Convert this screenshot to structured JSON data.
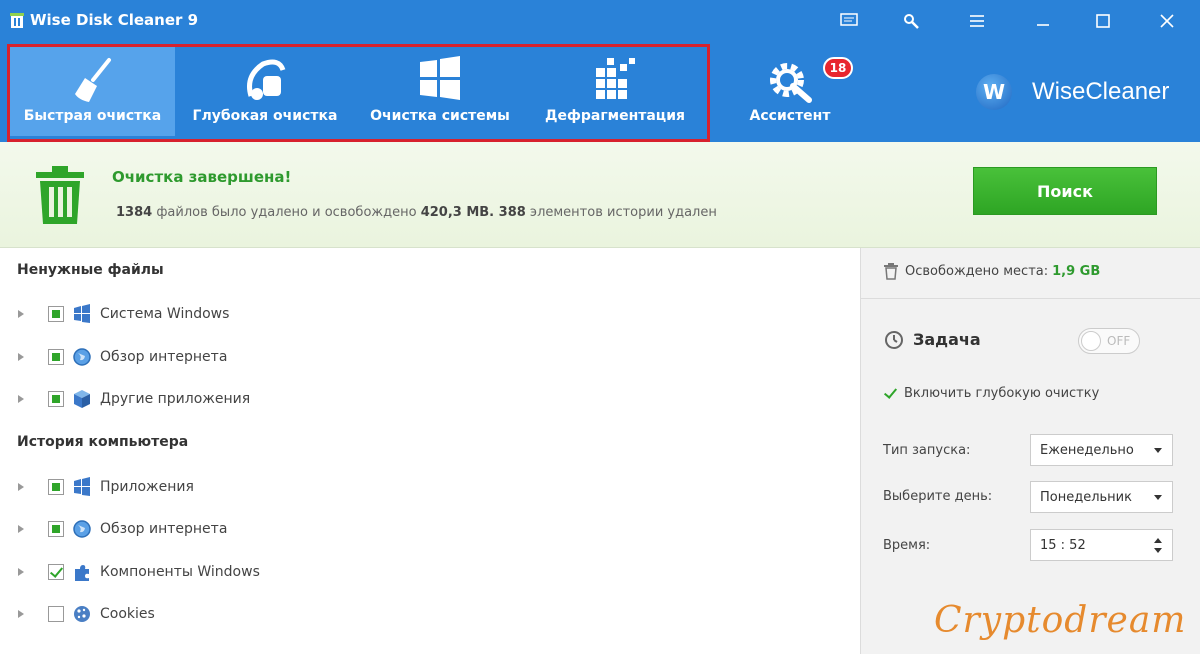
{
  "window": {
    "title": "Wise Disk Cleaner 9"
  },
  "toolbar": {
    "items": [
      {
        "label": "Быстрая очистка"
      },
      {
        "label": "Глубокая очистка"
      },
      {
        "label": "Очистка системы"
      },
      {
        "label": "Дефрагментация"
      },
      {
        "label": "Ассистент",
        "badge": "18"
      }
    ],
    "brand": "WiseCleaner",
    "brand_logo": "W"
  },
  "status": {
    "title": "Очистка завершена!",
    "files_count": "1384",
    "text1": " файлов было удалено и освобождено ",
    "freed_size": "420,3 MB.",
    "history_count": " 388",
    "text2": " элементов истории удален",
    "search_label": "Поиск"
  },
  "junk": {
    "title": "Ненужные файлы",
    "items": [
      {
        "label": "Система Windows",
        "icon": "windows-icon",
        "state": "partial"
      },
      {
        "label": "Обзор интернета",
        "icon": "globe-icon",
        "state": "partial"
      },
      {
        "label": "Другие приложения",
        "icon": "package-icon",
        "state": "partial"
      }
    ]
  },
  "history": {
    "title": "История компьютера",
    "items": [
      {
        "label": "Приложения",
        "icon": "windows-icon",
        "state": "partial"
      },
      {
        "label": "Обзор интернета",
        "icon": "globe-icon",
        "state": "partial"
      },
      {
        "label": "Компоненты Windows",
        "icon": "puzzle-icon",
        "state": "checked"
      },
      {
        "label": "Cookies",
        "icon": "cookie-icon",
        "state": "unchecked"
      }
    ]
  },
  "sidebar": {
    "freed_label": "Освобождено места:",
    "freed_value": "1,9 GB",
    "task_label": "Задача",
    "toggle_label": "OFF",
    "deep_clean_label": "Включить глубокую очистку",
    "launch_type_label": "Тип запуска:",
    "launch_type_value": "Еженедельно",
    "day_label": "Выберите день:",
    "day_value": "Понедельник",
    "time_label": "Время:",
    "time_value": "15 : 52"
  },
  "watermark": "Cryptodream",
  "colors": {
    "accent": "#2a82d8",
    "green": "#2e9a2e",
    "highlight": "#d7222e"
  }
}
